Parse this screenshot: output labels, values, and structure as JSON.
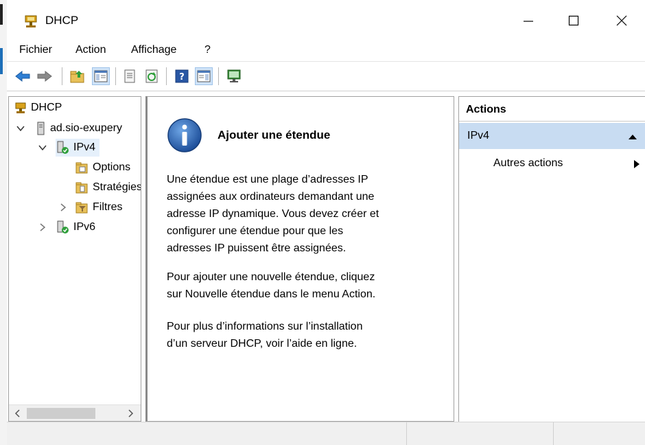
{
  "window": {
    "title": "DHCP",
    "minimize_glyph": "—",
    "maximize_glyph": "☐",
    "close_glyph": "✕"
  },
  "menu": {
    "items": [
      "Fichier",
      "Action",
      "Affichage",
      "?"
    ]
  },
  "toolbar": {
    "icons": [
      "back-arrow-icon",
      "forward-arrow-icon",
      "up-folder-icon",
      "show-hide-console-tree-icon",
      "properties-icon",
      "refresh-icon",
      "help-icon",
      "show-hide-action-pane-icon",
      "monitor-icon"
    ]
  },
  "tree": {
    "root": "DHCP",
    "server": "ad.sio-exupery",
    "ipv4": "IPv4",
    "options": "Options",
    "strategies": "Stratégies",
    "filters": "Filtres",
    "ipv6": "IPv6"
  },
  "content": {
    "title": "Ajouter une étendue",
    "para1": "Une étendue est une plage d’adresses IP\nassignées aux ordinateurs demandant une\nadresse IP dynamique. Vous devez créer et\nconfigurer une étendue pour que les\nadresses IP puissent être assignées.",
    "para2": "Pour ajouter une nouvelle étendue, cliquez\nsur Nouvelle étendue dans le menu Action.",
    "para3": "Pour plus d’informations sur l’installation\nd’un serveur DHCP, voir l’aide en ligne."
  },
  "actions": {
    "header": "Actions",
    "section": "IPv4",
    "more": "Autres actions"
  },
  "colors": {
    "selection": "#e5f0fb",
    "actions_section": "#c8dcf2",
    "info_blue": "#1e5aa8"
  }
}
